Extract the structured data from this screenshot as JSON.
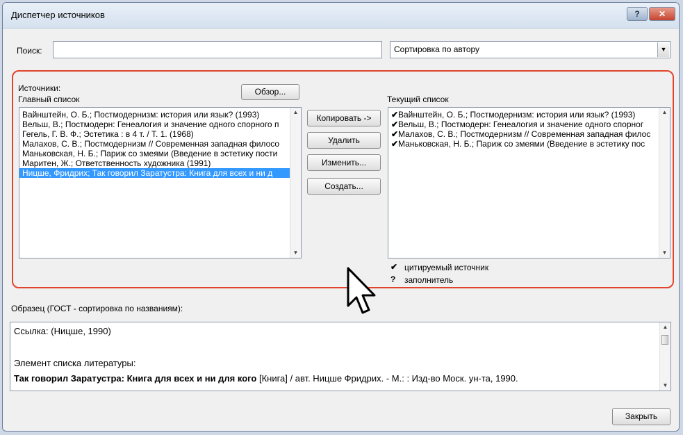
{
  "window": {
    "title": "Диспетчер источников",
    "help_label": "?",
    "close_label": "✕"
  },
  "search": {
    "label": "Поиск:",
    "value": "",
    "sort_value": "Сортировка по автору"
  },
  "sources": {
    "label": "Источники:",
    "master_label": "Главный список",
    "browse_button": "Обзор...",
    "master_items": [
      "Вайнштейн, О. Б.; Постмодернизм: история или язык? (1993)",
      "Вельш, В.; Постмодерн: Генеалогия и значение одного спорного п",
      "Гегель, Г. В. Ф.; Эстетика : в 4 т. / Т. 1. (1968)",
      "Малахов, С. В.; Постмодернизм // Современная западная филосо",
      "Маньковская, Н. Б.; Париж со змеями (Введение в эстетику пости",
      "Маритен, Ж.; Ответственность художника (1991)",
      "Ницше, Фридрих; Так говорил Заратустра: Книга для всех и ни д"
    ],
    "current_label": "Текущий список",
    "current_items": [
      "Вайнштейн, О. Б.; Постмодернизм: история или язык? (1993)",
      "Вельш, В.; Постмодерн: Генеалогия и значение одного спорног",
      "Малахов, С. В.; Постмодернизм // Современная западная филос",
      "Маньковская, Н. Б.; Париж со змеями (Введение в эстетику пос"
    ],
    "check_mark": "✔"
  },
  "actions": {
    "copy": "Копировать ->",
    "delete": "Удалить",
    "edit": "Изменить...",
    "create": "Создать..."
  },
  "legend": {
    "cited_symbol": "✔",
    "cited_label": "цитируемый источник",
    "placeholder_symbol": "?",
    "placeholder_label": "заполнитель"
  },
  "preview": {
    "label": "Образец (ГОСТ - сортировка по названиям):",
    "citation": "Ссылка:  (Ницше, 1990)",
    "bib_heading": "Элемент списка литературы:",
    "bib_title": "Так говорил Заратустра: Книга для всех и ни для кого",
    "bib_rest": " [Книга] / авт. Ницше Фридрих. - М.: : Изд-во Моск. ун-та, 1990."
  },
  "footer": {
    "close_button": "Закрыть"
  },
  "colors": {
    "highlight_frame": "#e2442b",
    "selection": "#3399ff"
  }
}
